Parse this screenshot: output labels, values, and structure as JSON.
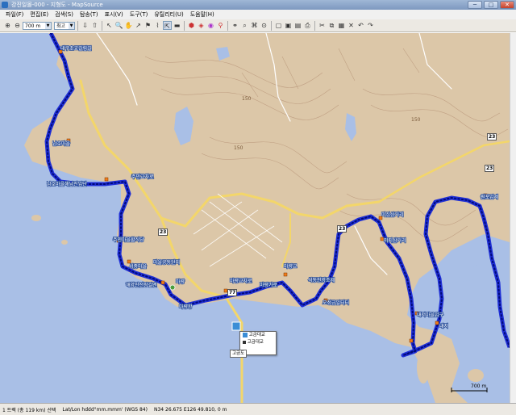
{
  "window": {
    "title": "강진일몰-000 - 지형도 - MapSource",
    "min_label": "─",
    "max_label": "□",
    "close_label": "✕"
  },
  "menu": [
    "파일(F)",
    "편집(E)",
    "검색(S)",
    "탐송(T)",
    "표시(V)",
    "도구(T)",
    "유틸리티(U)",
    "도움말(H)"
  ],
  "toolbar": {
    "zoom_value": "700 m",
    "detail_value": "최고"
  },
  "map": {
    "labels": [
      "대구초교갈림길",
      "남호마을",
      "남호마을해남진입단",
      "주민교차로",
      "주민마을할식당",
      "서중마을",
      "마을공동단지",
      "마량",
      "해양진선장길엔",
      "마량항",
      "마량교차로",
      "마량교",
      "마량가로",
      "석동진방조제",
      "오성금일터터",
      "미심삼거리",
      "미지삼거리",
      "내저마을입구",
      "내저",
      "원포입제"
    ],
    "road_badges": [
      "23",
      "23",
      "23",
      "23",
      "77"
    ],
    "numbers": [
      "150",
      "150",
      "150"
    ],
    "scale": "700 m",
    "popup_items": [
      "고금대교",
      "고금대교"
    ],
    "tooltip": "고금도"
  },
  "status": {
    "track": "1 트랙 (총 119 km) 선택",
    "format": "Lat/Lon hddd°mm.mmm' (WGS 84)",
    "coords": "N34 26.675 E126 49.810, 0 m"
  },
  "colors": {
    "track": "#1f2fd6",
    "water": "#a9bfe6",
    "land": "#dcc7a8",
    "road": "#f3d66a"
  }
}
